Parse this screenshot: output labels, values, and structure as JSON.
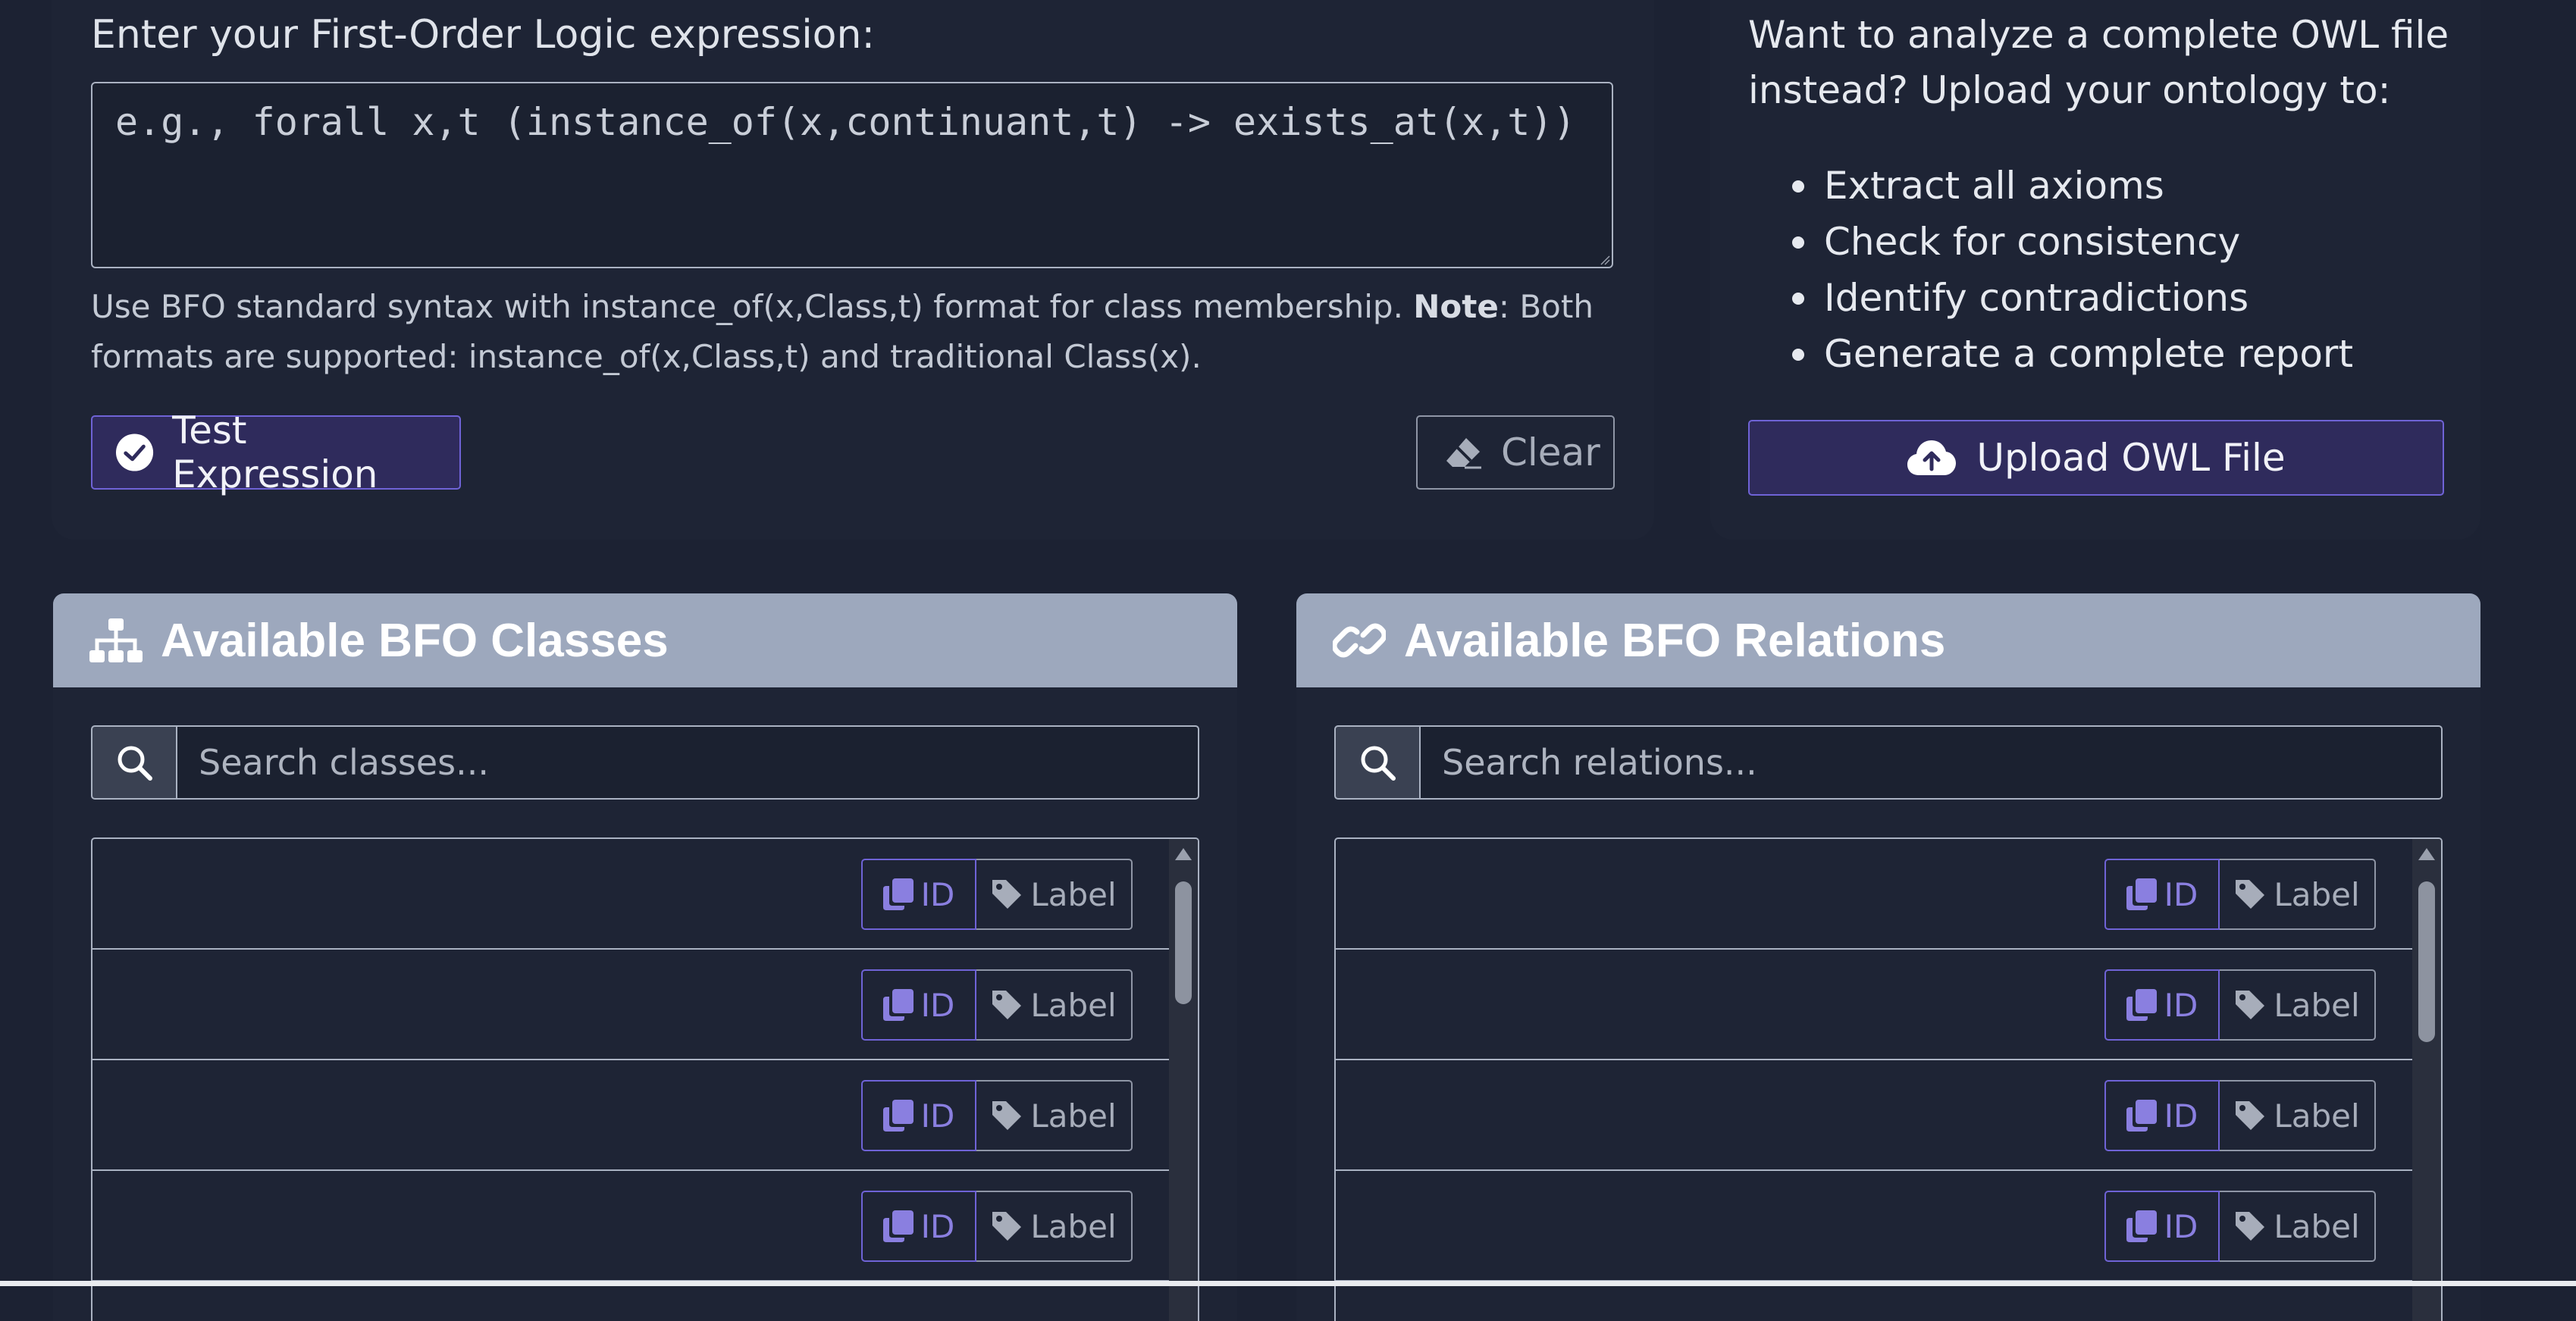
{
  "fol": {
    "label": "Enter your First-Order Logic expression:",
    "placeholder": "e.g., forall x,t (instance_of(x,continuant,t) -> exists_at(x,t))",
    "help_part1": "Use BFO standard syntax with instance_of(x,Class,t) format for class membership. ",
    "help_bold": "Note",
    "help_part2": ": Both formats are supported: instance_of(x,Class,t) and traditional Class(x).",
    "test_button": "Test Expression",
    "clear_button": "Clear"
  },
  "owl": {
    "intro": "Want to analyze a complete OWL file instead? Upload your ontology to:",
    "features": [
      "Extract all axioms",
      "Check for consistency",
      "Identify contradictions",
      "Generate a complete report"
    ],
    "upload_button": "Upload OWL File"
  },
  "classes_panel": {
    "title": "Available BFO Classes",
    "search_placeholder": "Search classes...",
    "rows": [
      {
        "id_label": "ID",
        "label_label": "Label"
      },
      {
        "id_label": "ID",
        "label_label": "Label"
      },
      {
        "id_label": "ID",
        "label_label": "Label"
      },
      {
        "id_label": "ID",
        "label_label": "Label"
      }
    ]
  },
  "relations_panel": {
    "title": "Available BFO Relations",
    "search_placeholder": "Search relations...",
    "rows": [
      {
        "id_label": "ID",
        "label_label": "Label"
      },
      {
        "id_label": "ID",
        "label_label": "Label"
      },
      {
        "id_label": "ID",
        "label_label": "Label"
      },
      {
        "id_label": "ID",
        "label_label": "Label"
      }
    ]
  },
  "colors": {
    "background": "#1c2233",
    "accent": "#6f63d6",
    "panel_header": "#9da8bd"
  },
  "icons": {
    "test": "check-circle-icon",
    "clear": "eraser-icon",
    "upload": "cloud-upload-icon",
    "classes_header": "sitemap-icon",
    "relations_header": "link-icon",
    "search": "search-icon",
    "copy_id": "copy-icon",
    "label": "tag-icon"
  }
}
